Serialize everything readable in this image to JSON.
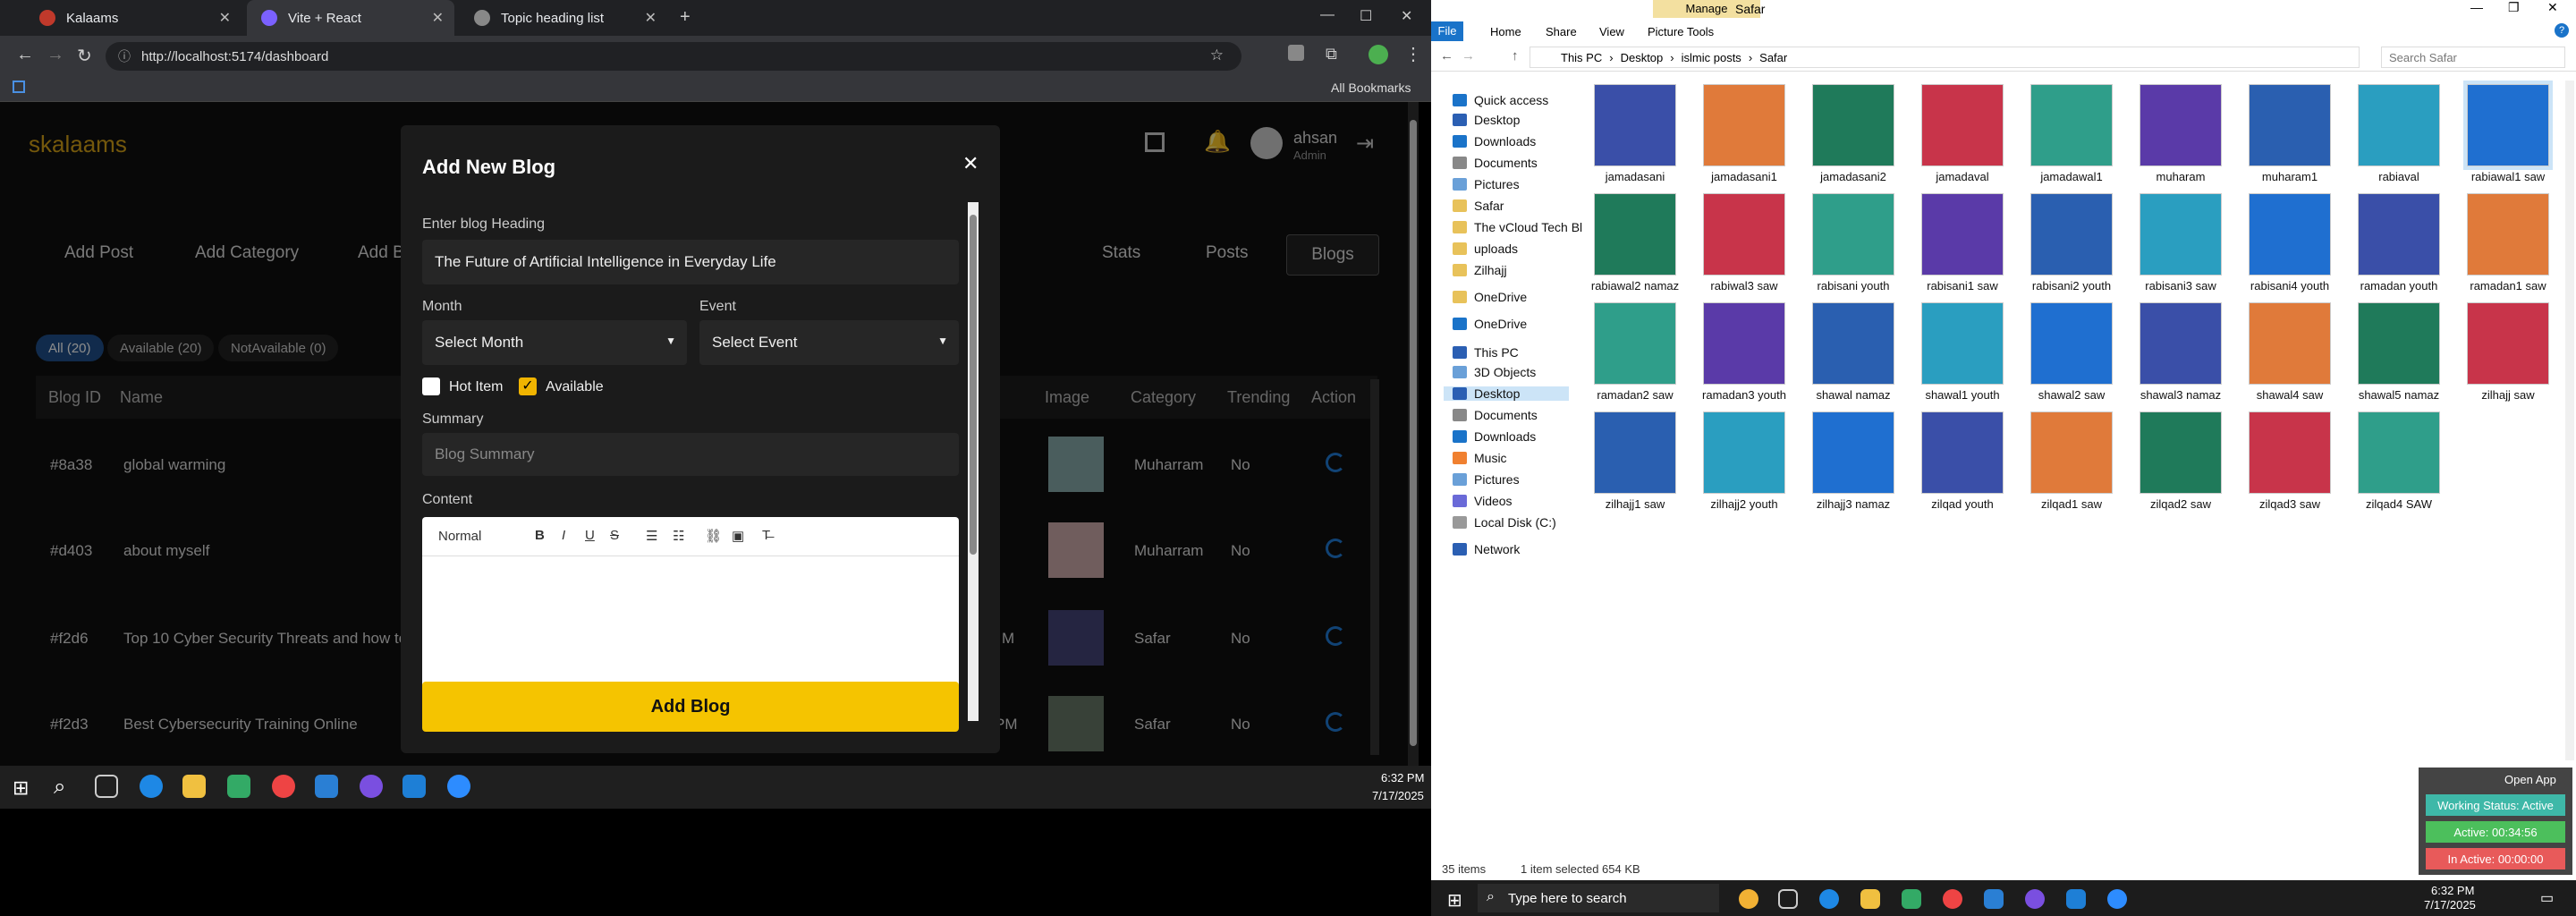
{
  "browser": {
    "tabs": [
      {
        "label": "Kalaams"
      },
      {
        "label": "Vite + React"
      },
      {
        "label": "Topic heading list"
      }
    ],
    "url": "http://localhost:5174/dashboard",
    "bookmarks": "All Bookmarks"
  },
  "app": {
    "logo": "skalaams",
    "user": {
      "name": "ahsan",
      "role": "Admin"
    },
    "nav_left": [
      "Add Post",
      "Add Category",
      "Add Bl"
    ],
    "nav_right": [
      "Stats",
      "Posts",
      "Blogs"
    ],
    "filters": [
      "All (20)",
      "Available (20)",
      "NotAvailable (0)"
    ],
    "columns": [
      "Blog ID",
      "Name",
      "Image",
      "Category",
      "Trending",
      "Action"
    ],
    "rows": [
      {
        "id": "#8a38",
        "name": "global warming",
        "time": "",
        "category": "Muharram",
        "trending": "No"
      },
      {
        "id": "#d403",
        "name": "about myself",
        "time": "",
        "category": "Muharram",
        "trending": "No"
      },
      {
        "id": "#f2d6",
        "name": "Top 10 Cyber Security Threats and how to",
        "time": "M",
        "category": "Safar",
        "trending": "No"
      },
      {
        "id": "#f2d3",
        "name": "Best Cybersecurity Training Online",
        "time": "PM",
        "category": "Safar",
        "trending": "No"
      }
    ]
  },
  "modal": {
    "title": "Add New Blog",
    "heading_label": "Enter blog Heading",
    "heading_value": "The Future of Artificial Intelligence in Everyday Life",
    "month_label": "Month",
    "month_value": "Select Month",
    "event_label": "Event",
    "event_value": "Select Event",
    "hot_item": "Hot Item",
    "available": "Available",
    "summary_label": "Summary",
    "summary_placeholder": "Blog Summary",
    "content_label": "Content",
    "editor_style": "Normal",
    "submit": "Add Blog"
  },
  "taskbar_left": {
    "time": "6:32 PM",
    "date": "7/17/2025"
  },
  "explorer": {
    "window_title": "Safar",
    "manage": "Manage",
    "ribbon_tabs": [
      "File",
      "Home",
      "Share",
      "View",
      "Picture Tools"
    ],
    "breadcrumb": [
      "This PC",
      "Desktop",
      "islmic posts",
      "Safar"
    ],
    "search_placeholder": "Search Safar",
    "nav": [
      "Quick access",
      "Desktop",
      "Downloads",
      "Documents",
      "Pictures",
      "Safar",
      "The vCloud Tech Bl",
      "uploads",
      "Zilhajj",
      "OneDrive",
      "OneDrive",
      "This PC",
      "3D Objects",
      "Desktop",
      "Documents",
      "Downloads",
      "Music",
      "Pictures",
      "Videos",
      "Local Disk (C:)",
      "Network"
    ],
    "files": [
      "jamadasani",
      "jamadasani1",
      "jamadasani2",
      "jamadaval",
      "jamadawal1",
      "muharam",
      "muharam1",
      "rabiaval",
      "rabiawal1 saw",
      "rabiawal2 namaz",
      "rabiwal3 saw",
      "rabisani youth",
      "rabisani1 saw",
      "rabisani2 youth",
      "rabisani3 saw",
      "rabisani4 youth",
      "ramadan youth",
      "ramadan1 saw",
      "ramadan2 saw",
      "ramadan3 youth",
      "shawal namaz",
      "shawal1 youth",
      "shawal2 saw",
      "shawal3 namaz",
      "shawal4 saw",
      "shawal5 namaz",
      "zilhajj saw",
      "zilhajj1 saw",
      "zilhajj2 youth",
      "zilhajj3 namaz",
      "zilqad youth",
      "zilqad1 saw",
      "zilqad2 saw",
      "zilqad3 saw",
      "zilqad4 SAW"
    ],
    "status_count": "35 items",
    "status_selected": "1 item selected  654 KB"
  },
  "widget": {
    "open_app": "Open App",
    "working": "Working Status: Active",
    "active": "Active: 00:34:56",
    "inactive": "In Active: 00:00:00"
  },
  "taskbar_right": {
    "search": "Type here to search",
    "time": "6:32 PM",
    "date": "7/17/2025"
  }
}
